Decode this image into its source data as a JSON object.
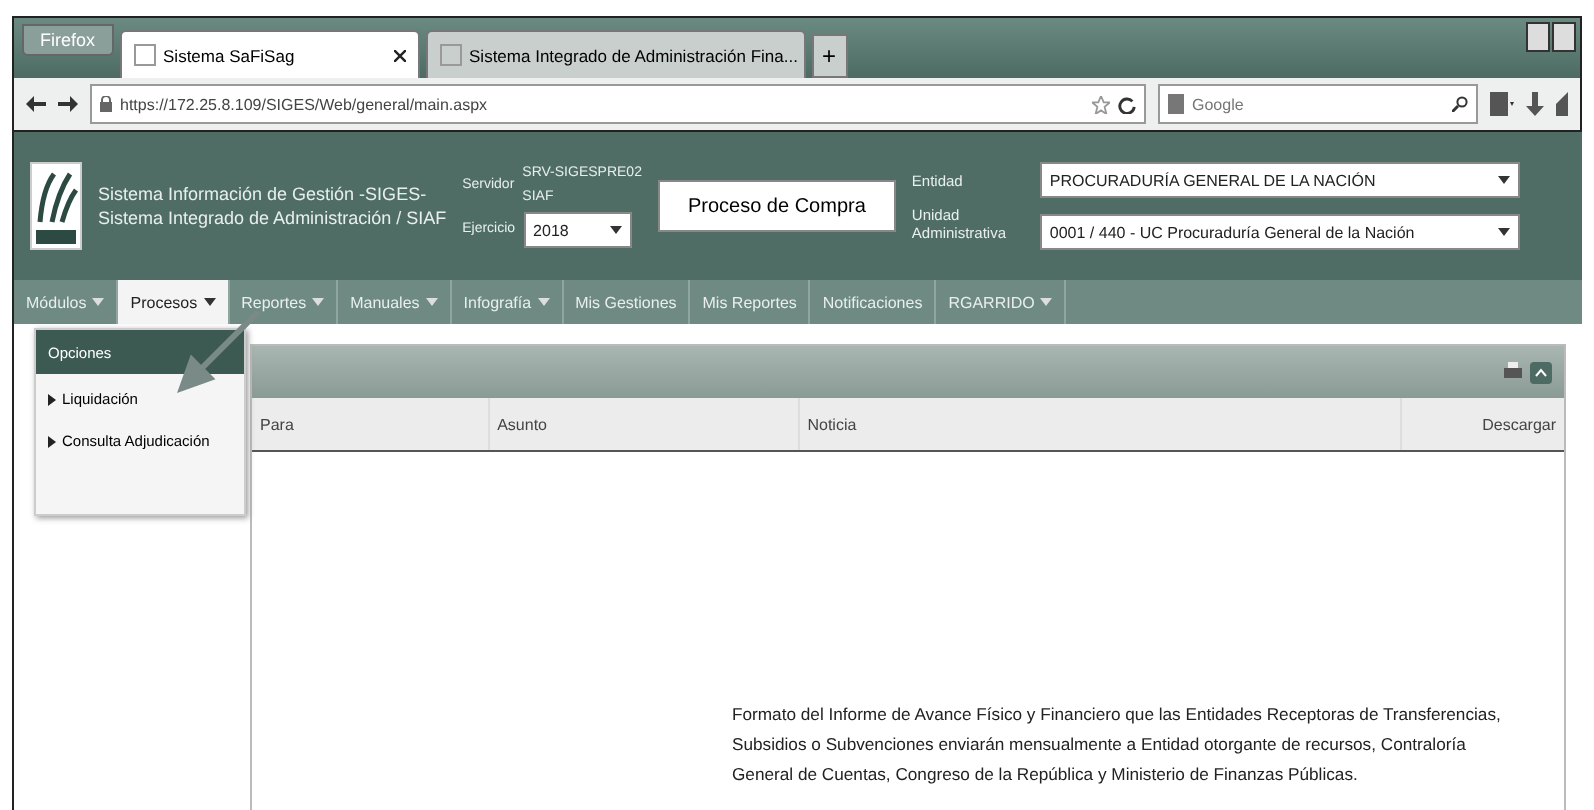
{
  "browser": {
    "menu_button": "Firefox",
    "tabs": [
      {
        "title": "Sistema SaFiSag",
        "selected": true
      },
      {
        "title": "Sistema Integrado de Administración Fina...",
        "selected": false
      }
    ],
    "new_tab": "+",
    "url": "https://172.25.8.109/SIGES/Web/general/main.aspx",
    "search": {
      "placeholder": "Google"
    }
  },
  "header": {
    "title_lines": [
      "Sistema Información de Gestión -SIGES-",
      "Sistema Integrado de Administración / SIAF"
    ],
    "servidor": {
      "label": "Servidor",
      "values": [
        "SRV-SIGESPRE02",
        "SIAF"
      ]
    },
    "ejercicio": {
      "label": "Ejercicio",
      "value": "2018"
    },
    "action_button": "Proceso de Compra",
    "entidad": {
      "label": "Entidad",
      "value": "PROCURADURÍA GENERAL DE LA NACIÓN"
    },
    "unidad": {
      "label": "Unidad Administrativa",
      "value": "0001 / 440 - UC Procuraduría General de la Nación"
    }
  },
  "menu": [
    {
      "label": "Módulos",
      "has_menu": true,
      "selected": false
    },
    {
      "label": "Procesos",
      "has_menu": true,
      "selected": true
    },
    {
      "label": "Reportes",
      "has_menu": true,
      "selected": false
    },
    {
      "label": "Manuales",
      "has_menu": true,
      "selected": false
    },
    {
      "label": "Infografía",
      "has_menu": true,
      "selected": false
    },
    {
      "label": "Mis Gestiones",
      "has_menu": false,
      "selected": false
    },
    {
      "label": "Mis Reportes",
      "has_menu": false,
      "selected": false
    },
    {
      "label": "Notificaciones",
      "has_menu": false,
      "selected": false
    },
    {
      "label": "RGARRIDO",
      "has_menu": true,
      "selected": false
    }
  ],
  "dropdown": {
    "header": "Opciones",
    "items": [
      "Liquidación",
      "Consulta Adjudicación"
    ]
  },
  "table": {
    "columns": [
      "Para",
      "Asunto",
      "Noticia",
      "Descargar"
    ]
  },
  "note": "Formato del Informe de Avance Físico y Financiero que las Entidades Receptoras de Transferencias, Subsidios o Subvenciones enviarán mensualmente a Entidad otorgante de recursos, Contraloría General de Cuentas, Congreso de la República y Ministerio de Finanzas Públicas."
}
